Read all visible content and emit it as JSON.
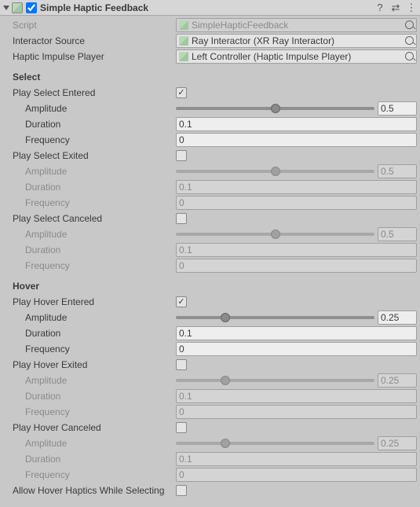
{
  "header": {
    "title": "Simple Haptic Feedback",
    "enabled": true
  },
  "refs": {
    "script_label": "Script",
    "script_value": "SimpleHapticFeedback",
    "interactor_label": "Interactor Source",
    "interactor_value": "Ray Interactor (XR Ray Interactor)",
    "haptic_label": "Haptic Impulse Player",
    "haptic_value": "Left Controller (Haptic Impulse Player)"
  },
  "select": {
    "title": "Select",
    "entered": {
      "label": "Play Select Entered",
      "checked": true,
      "amplitude": 0.5,
      "duration": "0.1",
      "frequency": "0"
    },
    "exited": {
      "label": "Play Select Exited",
      "checked": false,
      "amplitude": 0.5,
      "duration": "0.1",
      "frequency": "0"
    },
    "canceled": {
      "label": "Play Select Canceled",
      "checked": false,
      "amplitude": 0.5,
      "duration": "0.1",
      "frequency": "0"
    }
  },
  "hover": {
    "title": "Hover",
    "entered": {
      "label": "Play Hover Entered",
      "checked": true,
      "amplitude": 0.25,
      "duration": "0.1",
      "frequency": "0"
    },
    "exited": {
      "label": "Play Hover Exited",
      "checked": false,
      "amplitude": 0.25,
      "duration": "0.1",
      "frequency": "0"
    },
    "canceled": {
      "label": "Play Hover Canceled",
      "checked": false,
      "amplitude": 0.25,
      "duration": "0.1",
      "frequency": "0"
    }
  },
  "allow_hover_label": "Allow Hover Haptics While Selecting",
  "labels": {
    "amplitude": "Amplitude",
    "duration": "Duration",
    "frequency": "Frequency"
  },
  "chart_data": null
}
